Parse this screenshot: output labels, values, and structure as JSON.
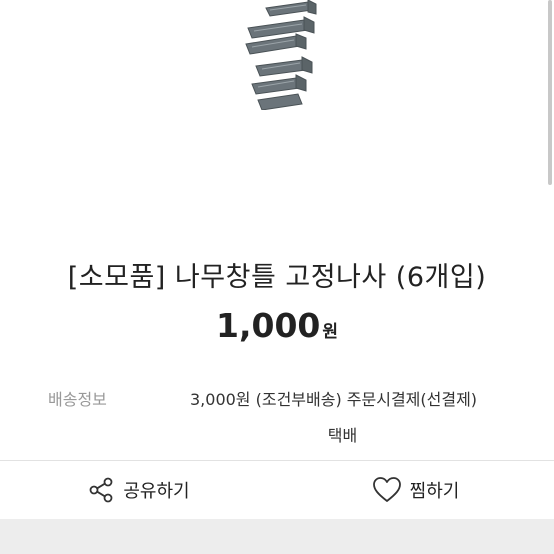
{
  "product": {
    "title": "[소모품] 나무창틀 고정나사 (6개입)",
    "price_amount": "1,000",
    "price_unit": "원"
  },
  "shipping": {
    "label": "배송정보",
    "detail": "3,000원 (조건부배송) 주문시결제(선결제)",
    "method": "택배"
  },
  "actions": {
    "share_label": "공유하기",
    "like_label": "찜하기"
  },
  "icons": {
    "share": "share-icon",
    "like": "heart-icon"
  }
}
